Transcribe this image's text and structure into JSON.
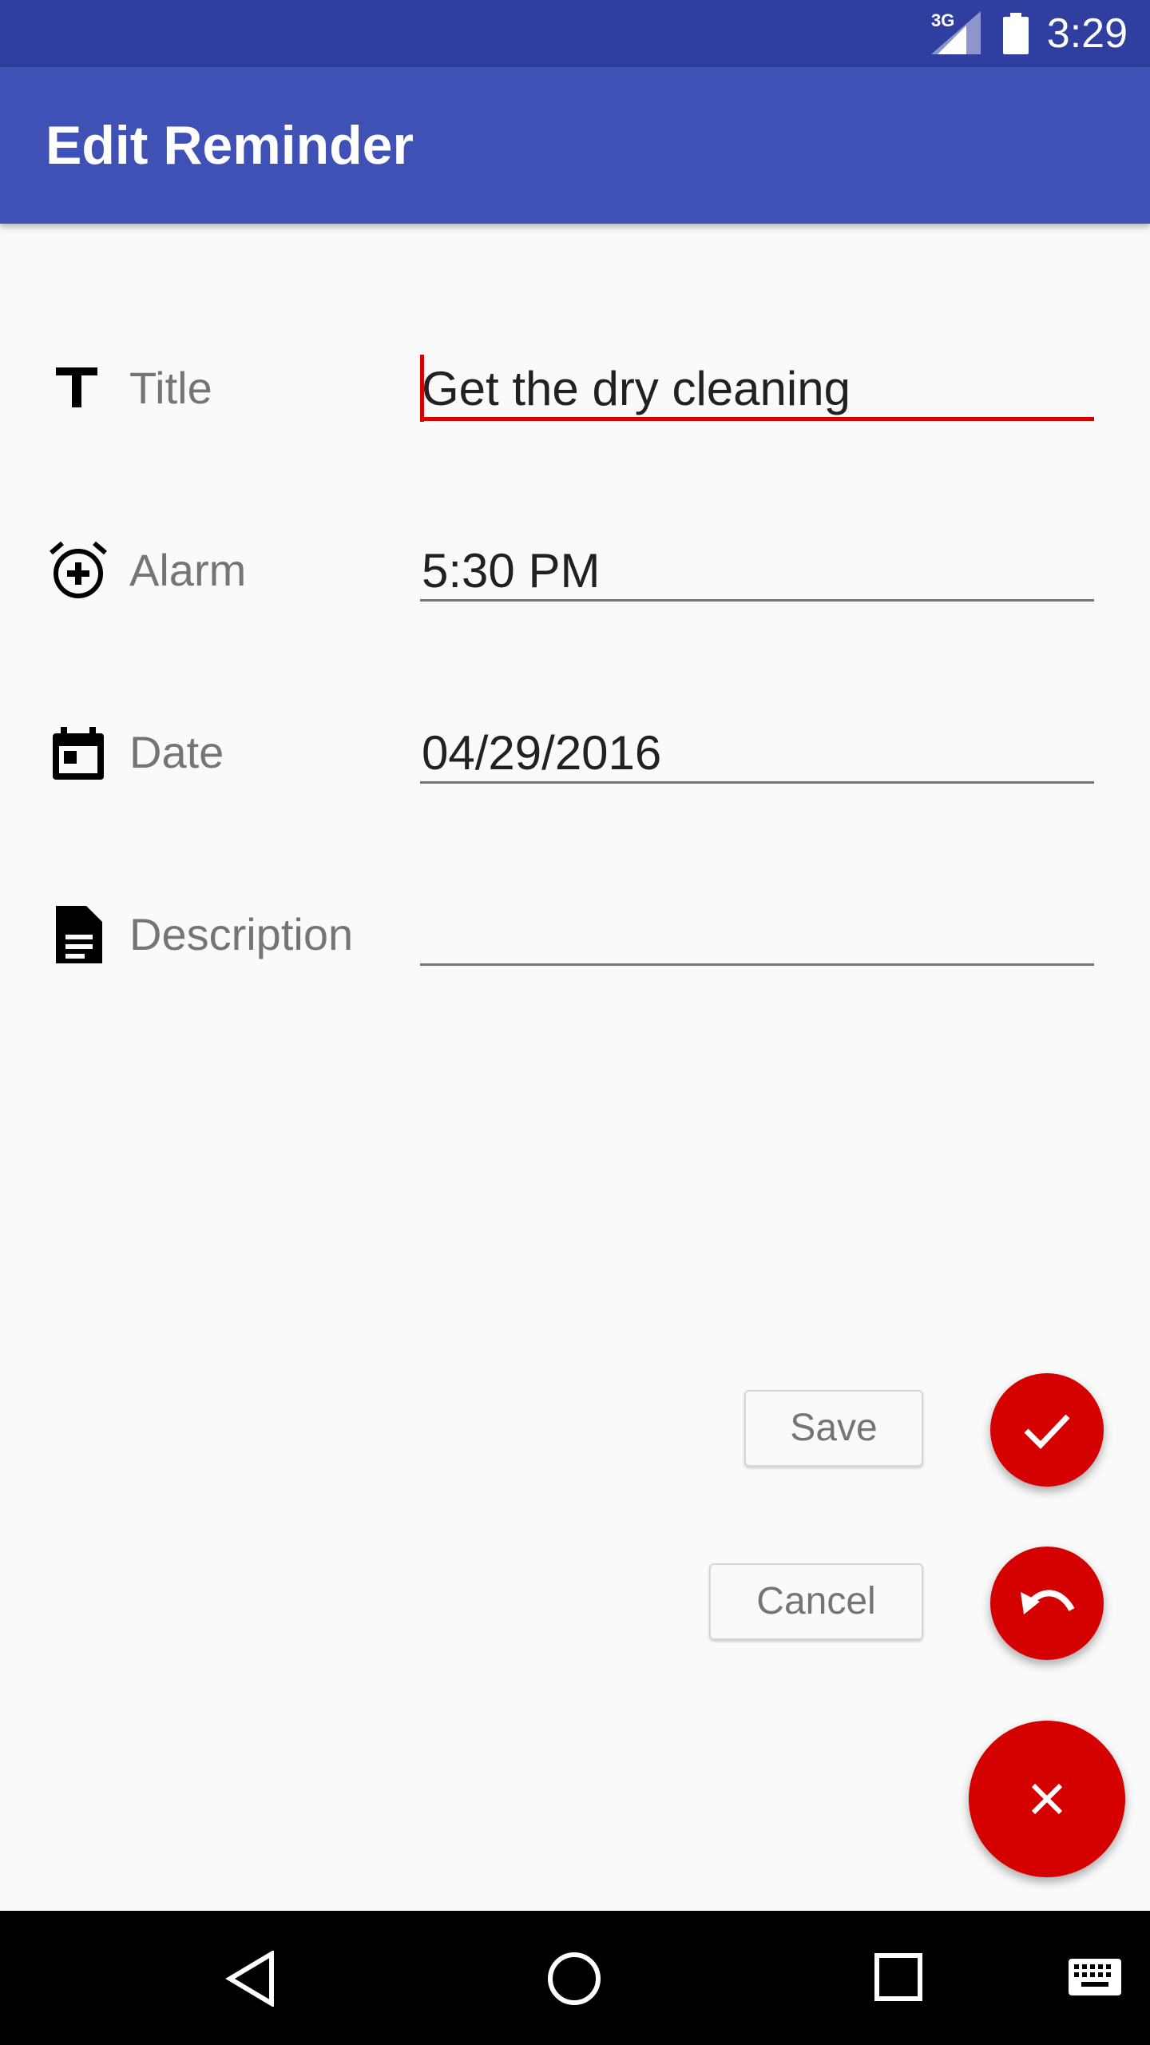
{
  "status_bar": {
    "time": "3:29",
    "network": "3G"
  },
  "app_bar": {
    "title": "Edit Reminder"
  },
  "form": {
    "title": {
      "label": "Title",
      "value": "Get the dry cleaning",
      "icon": "text-title-icon"
    },
    "alarm": {
      "label": "Alarm",
      "value": "5:30 PM",
      "icon": "alarm-add-icon"
    },
    "date": {
      "label": "Date",
      "value": "04/29/2016",
      "icon": "calendar-icon"
    },
    "description": {
      "label": "Description",
      "value": "",
      "icon": "document-icon"
    }
  },
  "actions": {
    "save_label": "Save",
    "cancel_label": "Cancel",
    "save_icon": "check-icon",
    "cancel_icon": "undo-icon",
    "close_icon": "close-icon"
  },
  "colors": {
    "status_bar": "#303f9f",
    "app_bar": "#3f51b5",
    "accent": "#d50000",
    "background": "#fafafa"
  }
}
